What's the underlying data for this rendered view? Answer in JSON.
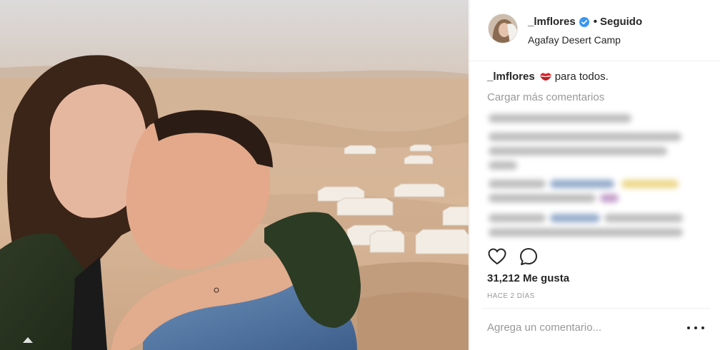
{
  "post": {
    "photo_alt": "Selfie de pareja en el desierto con campamento de tiendas al fondo"
  },
  "header": {
    "username": "_lmflores",
    "verified": true,
    "separator": "•",
    "follow_state": "Seguido",
    "location": "Agafay Desert Camp"
  },
  "caption": {
    "username": "_lmflores",
    "emoji_icon": "kiss-lips-icon",
    "text": "para todos."
  },
  "comments": {
    "load_more_label": "Cargar más comentarios"
  },
  "actions": {
    "like_icon": "heart-icon",
    "comment_icon": "comment-bubble-icon"
  },
  "likes": {
    "label": "31,212 Me gusta"
  },
  "timestamp": {
    "label": "HACE 2 DÍAS"
  },
  "add_comment": {
    "placeholder": "Agrega un comentario...",
    "more_icon": "more-options-icon"
  },
  "colors": {
    "text": "#262626",
    "muted": "#999999",
    "verified_blue": "#3897f0",
    "divider": "#efefef",
    "kiss_red": "#d8262e"
  }
}
